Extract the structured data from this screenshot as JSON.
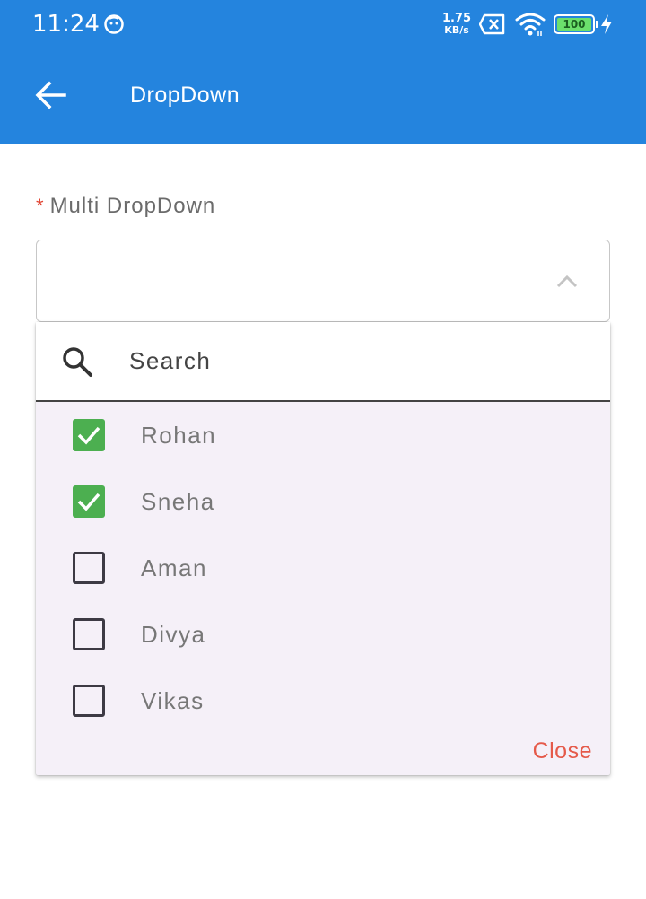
{
  "status_bar": {
    "time": "11:24",
    "net_speed_value": "1.75",
    "net_speed_unit": "KB/s",
    "battery_level": "100",
    "icons": [
      "app-notification-icon",
      "sim-no-signal-icon",
      "wifi-icon",
      "battery-icon",
      "charging-bolt-icon"
    ]
  },
  "app_bar": {
    "title": "DropDown",
    "back_icon": "arrow-back-icon",
    "background_color": "#2484de"
  },
  "field": {
    "required_mark": "*",
    "label": "Multi DropDown",
    "expanded": true,
    "chevron_icon": "chevron-up-icon"
  },
  "popup": {
    "search_placeholder": "Search",
    "search_value": "",
    "options": [
      {
        "label": "Rohan",
        "checked": true
      },
      {
        "label": "Sneha",
        "checked": true
      },
      {
        "label": "Aman",
        "checked": false
      },
      {
        "label": "Divya",
        "checked": false
      },
      {
        "label": "Vikas",
        "checked": false
      }
    ],
    "close_label": "Close",
    "checked_color": "#4caf50",
    "close_color": "#e55a4a"
  }
}
